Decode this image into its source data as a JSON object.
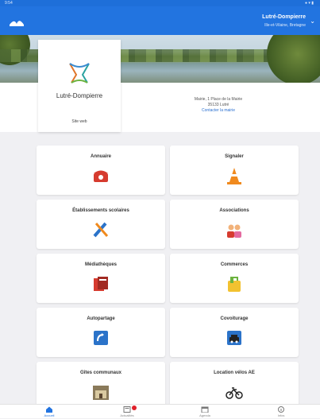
{
  "status": {
    "time": "9:54",
    "right": "● ▾ ▮"
  },
  "header": {
    "city": "Lutré-Dompierre",
    "subtitle": "Ille-et-Vilaine, Bretagne",
    "menu_icon": "chevron-down-icon"
  },
  "municipality": {
    "name": "Lutré-Dompierre",
    "website_label": "Site web",
    "address_line1": "Mairie, 1 Place de la Mairie",
    "address_line2": "35133 Lutré",
    "contact_link": "Contacter la mairie"
  },
  "tiles": [
    {
      "label": "Annuaire",
      "icon": "phone-icon"
    },
    {
      "label": "Signaler",
      "icon": "traffic-cone-icon"
    },
    {
      "label": "Établissements scolaires",
      "icon": "school-supplies-icon"
    },
    {
      "label": "Associations",
      "icon": "people-icon"
    },
    {
      "label": "Médiathèques",
      "icon": "books-icon"
    },
    {
      "label": "Commerces",
      "icon": "shopping-bag-icon"
    },
    {
      "label": "Autopartage",
      "icon": "car-sharing-icon"
    },
    {
      "label": "Covoiturage",
      "icon": "car-icon"
    },
    {
      "label": "Gîtes communaux",
      "icon": "cottage-photo-icon"
    },
    {
      "label": "Location vélos AE",
      "icon": "bicycle-icon"
    }
  ],
  "tabbar": [
    {
      "label": "Accueil",
      "icon": "home-icon",
      "color": "#2274e0"
    },
    {
      "label": "Actualités",
      "icon": "news-icon",
      "badge": true
    },
    {
      "label": "Agenda",
      "icon": "calendar-icon"
    },
    {
      "label": "Infos",
      "icon": "info-icon"
    }
  ],
  "colors": {
    "primary": "#2274e0",
    "tile_icon_red": "#d63b2f",
    "tile_icon_orange": "#f08a1e",
    "tile_icon_blue": "#2b73c9"
  }
}
